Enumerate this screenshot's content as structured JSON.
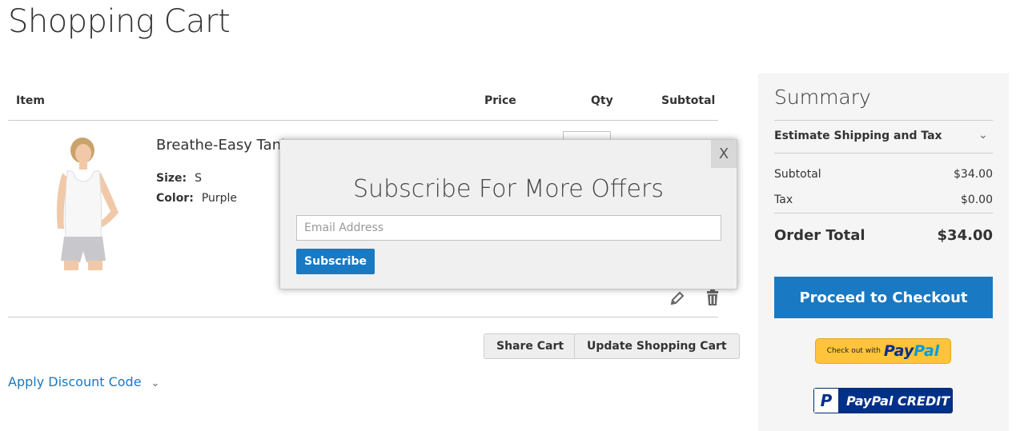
{
  "page": {
    "title": "Shopping Cart"
  },
  "cart": {
    "columns": {
      "item": "Item",
      "price": "Price",
      "qty": "Qty",
      "subtotal": "Subtotal"
    },
    "item": {
      "name": "Breathe-Easy Tank",
      "options": [
        {
          "label": "Size:",
          "value": "S"
        },
        {
          "label": "Color:",
          "value": "Purple"
        }
      ],
      "image_icon": "product-photo-woman-tank-top",
      "actions": {
        "edit_icon": "pencil-icon",
        "remove_icon": "trash-icon"
      }
    },
    "buttons": {
      "share": "Share Cart",
      "update": "Update Shopping Cart"
    },
    "discount": {
      "label": "Apply Discount Code"
    }
  },
  "summary": {
    "title": "Summary",
    "estimate_label": "Estimate Shipping and Tax",
    "rows": [
      {
        "label": "Subtotal",
        "value": "$34.00"
      },
      {
        "label": "Tax",
        "value": "$0.00"
      }
    ],
    "order_total": {
      "label": "Order Total",
      "value": "$34.00"
    },
    "checkout_label": "Proceed to Checkout",
    "paypal": {
      "prefix": "Check out with",
      "brand_a": "Pay",
      "brand_b": "Pal"
    },
    "paypal_credit": {
      "logo": "P",
      "label": "PayPal CREDIT"
    }
  },
  "modal": {
    "close_label": "X",
    "title": "Subscribe For More Offers",
    "email_placeholder": "Email Address",
    "email_value": "",
    "subscribe_label": "Subscribe"
  },
  "colors": {
    "accent": "#1979c3",
    "summary_bg": "#f5f5f5",
    "paypal_yellow": "#ffc439",
    "paypal_navy": "#003087"
  }
}
